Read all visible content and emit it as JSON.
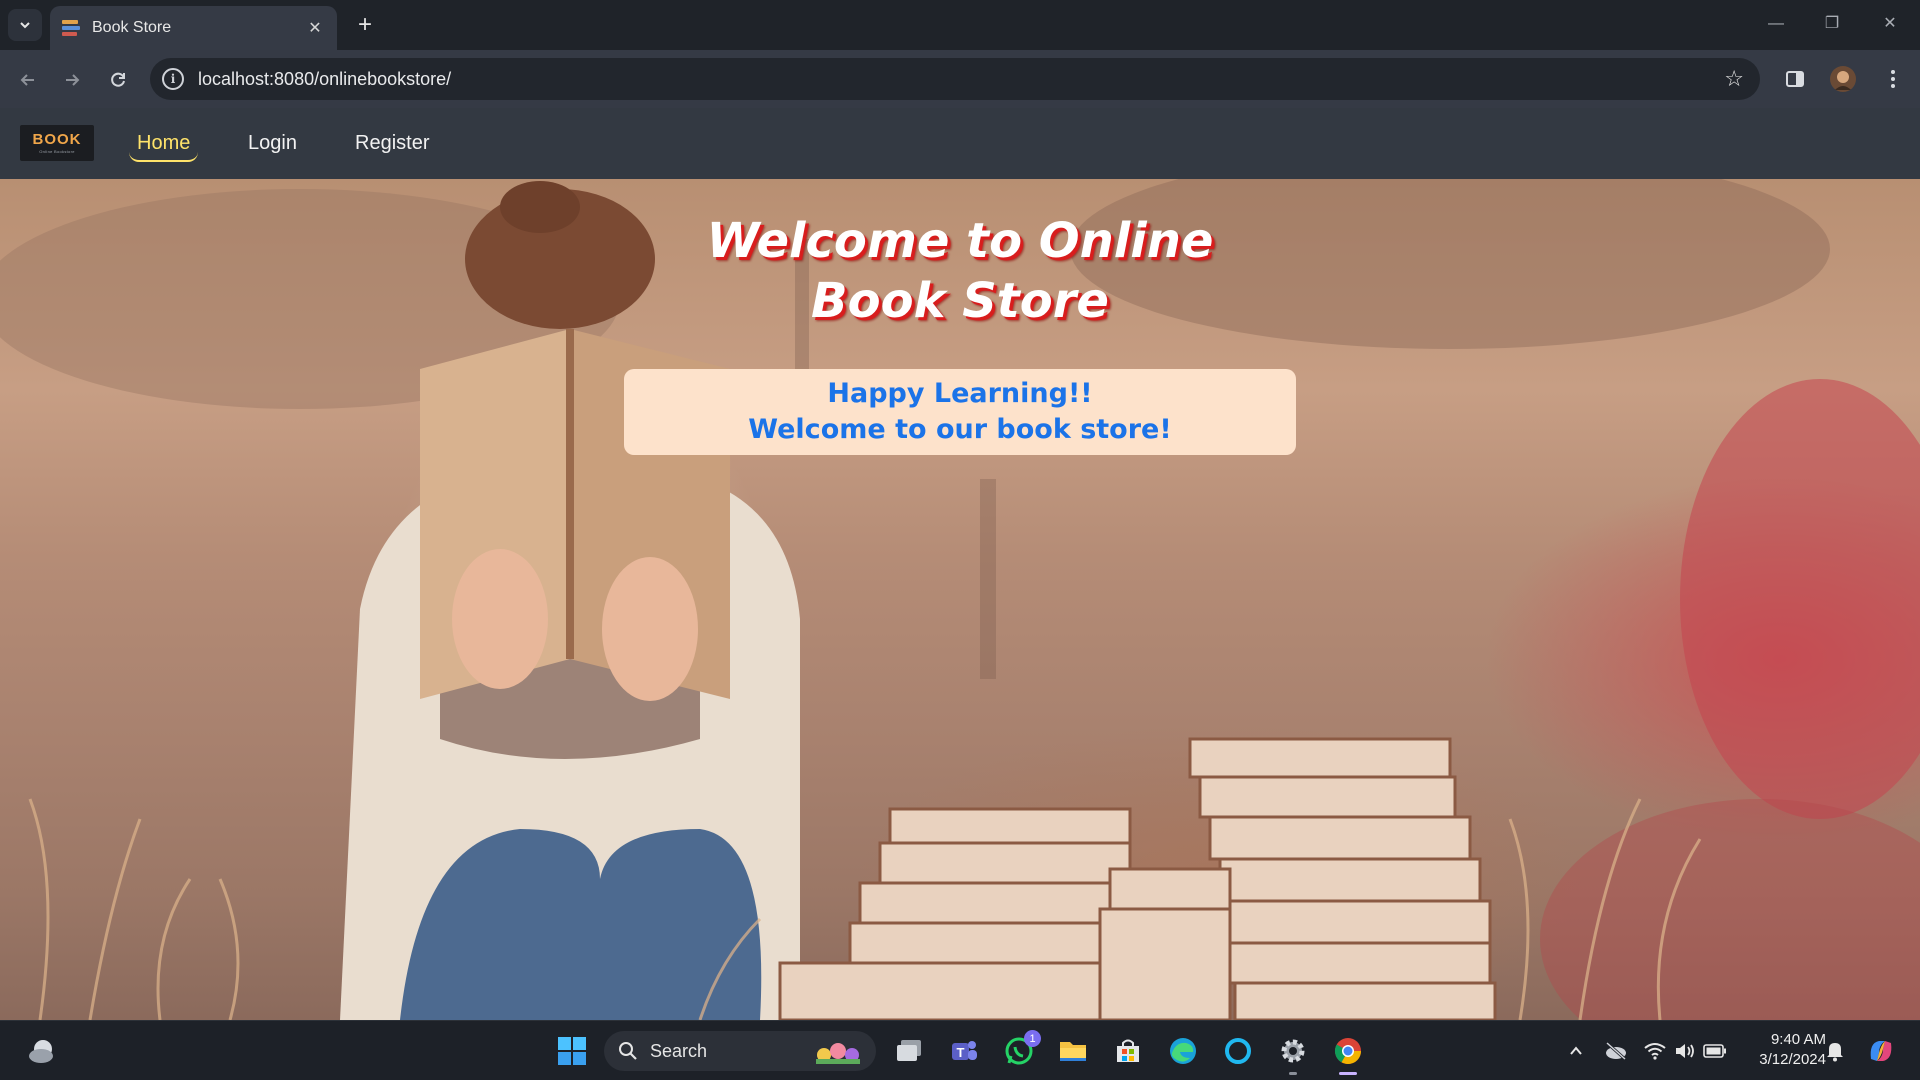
{
  "browser": {
    "tab_title": "Book Store",
    "url": "localhost:8080/onlinebookstore/"
  },
  "site": {
    "logo_text": "BOOK",
    "logo_subtext": "Online Bookstore",
    "nav": [
      {
        "label": "Home",
        "active": true
      },
      {
        "label": "Login",
        "active": false
      },
      {
        "label": "Register",
        "active": false
      }
    ]
  },
  "hero": {
    "title_line1": "Welcome to Online",
    "title_line2": "Book Store",
    "card_line1": "Happy Learning!!",
    "card_line2": "Welcome to our book store!"
  },
  "taskbar": {
    "search_label": "Search",
    "whatsapp_badge": "1",
    "time": "9:40 AM",
    "date": "3/12/2024"
  },
  "colors": {
    "nav_bg": "#333942",
    "nav_active": "#ffe36a",
    "title_shadow": "#d81d1d",
    "card_bg": "#fde2cb",
    "card_text": "#1b73e8"
  }
}
